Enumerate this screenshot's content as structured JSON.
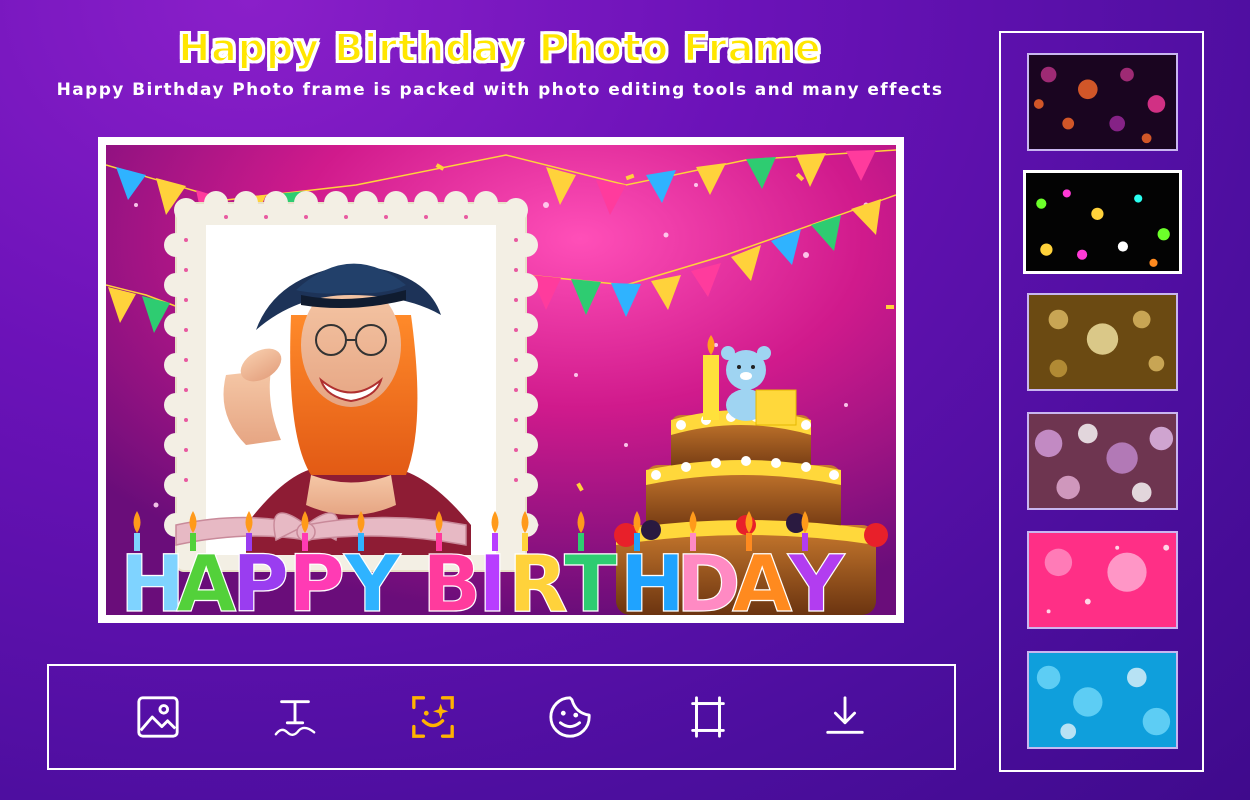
{
  "header": {
    "title": "Happy Birthday Photo Frame",
    "subtitle": "Happy Birthday Photo frame is packed with photo editing tools and many effects"
  },
  "canvas": {
    "banner_letters": [
      "H",
      "A",
      "P",
      "P",
      "Y",
      " ",
      "B",
      "I",
      "R",
      "T",
      "H",
      "D",
      "A",
      "Y"
    ],
    "banner_colors": [
      "#7fd3ff",
      "#53d13a",
      "#9a3df0",
      "#ff3bb4",
      "#2fb3ff",
      "#ffffff",
      "#ff3b9d",
      "#b83dff",
      "#ffd23b",
      "#2ecc71",
      "#1fa3ff",
      "#ff8ac3",
      "#ff8a1f",
      "#b23df0"
    ]
  },
  "toolbar": {
    "tools": [
      {
        "name": "gallery",
        "icon": "image-icon"
      },
      {
        "name": "text",
        "icon": "text-icon"
      },
      {
        "name": "effects",
        "icon": "sparkle-face-icon"
      },
      {
        "name": "sticker",
        "icon": "sticker-icon"
      },
      {
        "name": "crop",
        "icon": "crop-icon"
      },
      {
        "name": "download",
        "icon": "download-icon"
      }
    ],
    "active_color": "#ffb300",
    "icon_color": "#ffffff"
  },
  "backgrounds": {
    "selected_index": 1,
    "items": [
      {
        "name": "purple-bokeh",
        "colors": [
          "#1a0520",
          "#c0348a",
          "#ff6b2a"
        ]
      },
      {
        "name": "dark-multicolor-bokeh",
        "colors": [
          "#030303",
          "#6cff2a",
          "#ff3ad6"
        ]
      },
      {
        "name": "gold-bokeh",
        "colors": [
          "#6b4a12",
          "#e8c46a",
          "#fff2b0"
        ]
      },
      {
        "name": "pink-blur-bokeh",
        "colors": [
          "#6e3550",
          "#d8a0e0",
          "#ffffff"
        ]
      },
      {
        "name": "pink-sparkle",
        "colors": [
          "#ff2f86",
          "#ff8ec4",
          "#ffffff"
        ]
      },
      {
        "name": "blue-bokeh",
        "colors": [
          "#0f9fdc",
          "#7fe1ff",
          "#ffffff"
        ]
      }
    ]
  }
}
